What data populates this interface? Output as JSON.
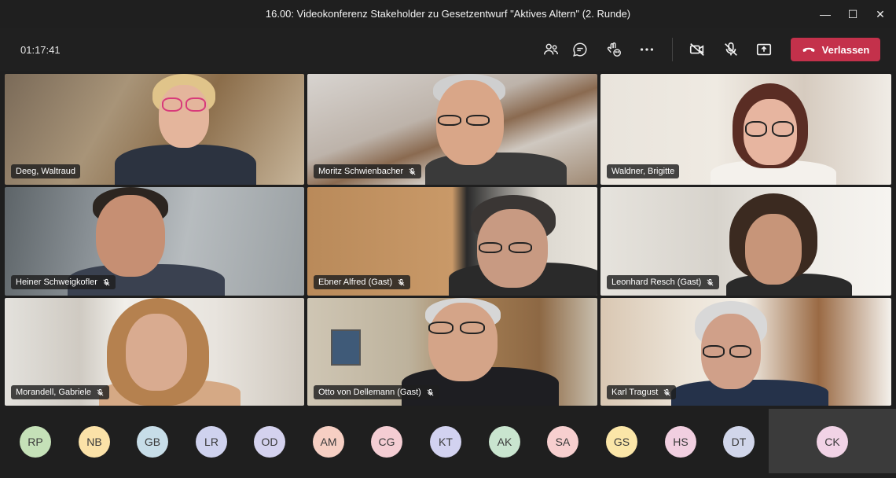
{
  "window": {
    "title": "16.00: Videokonferenz Stakeholder zu Gesetzentwurf \"Aktives Altern\" (2. Runde)",
    "minimize_glyph": "—",
    "maximize_glyph": "☐",
    "close_glyph": "✕"
  },
  "toolbar": {
    "timer": "01:17:41",
    "icons": [
      "people-icon",
      "chat-icon",
      "reactions-icon",
      "more-icon",
      "camera-off-icon",
      "mic-off-icon",
      "share-icon",
      "phone-icon"
    ],
    "leave_label": "Verlassen",
    "leave_color": "#c4314b"
  },
  "participants": [
    {
      "name": "Deeg, Waltraud",
      "muted": false
    },
    {
      "name": "Moritz Schwienbacher",
      "muted": true
    },
    {
      "name": "Waldner, Brigitte",
      "muted": false
    },
    {
      "name": "Heiner Schweigkofler",
      "muted": true
    },
    {
      "name": "Ebner Alfred (Gast)",
      "muted": true
    },
    {
      "name": "Leonhard Resch (Gast)",
      "muted": true
    },
    {
      "name": "Morandell, Gabriele",
      "muted": true
    },
    {
      "name": "Otto von Dellemann (Gast)",
      "muted": true
    },
    {
      "name": "Karl Tragust",
      "muted": true
    }
  ],
  "avatars": [
    {
      "initials": "RP",
      "color": "#c5e1b8"
    },
    {
      "initials": "NB",
      "color": "#fbe2a8"
    },
    {
      "initials": "GB",
      "color": "#c7dde8"
    },
    {
      "initials": "LR",
      "color": "#cfd2ee"
    },
    {
      "initials": "OD",
      "color": "#d4d2ee"
    },
    {
      "initials": "AM",
      "color": "#f6cfc3"
    },
    {
      "initials": "CG",
      "color": "#f4cdd3"
    },
    {
      "initials": "KT",
      "color": "#d2d2f0"
    },
    {
      "initials": "AK",
      "color": "#c9e5cf"
    },
    {
      "initials": "SA",
      "color": "#f7cfcf"
    },
    {
      "initials": "GS",
      "color": "#fbe6a8"
    },
    {
      "initials": "HS",
      "color": "#f1cfe0"
    },
    {
      "initials": "DT",
      "color": "#d1d6ea"
    },
    {
      "initials": "CK",
      "color": "#f1d3e6"
    }
  ]
}
